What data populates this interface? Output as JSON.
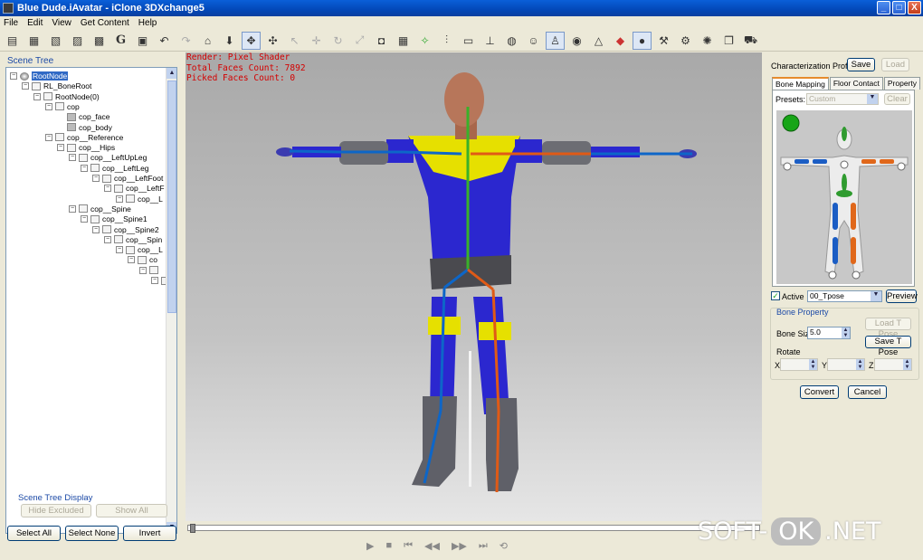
{
  "window": {
    "title": "Blue Dude.iAvatar - iClone 3DXchange5",
    "controls": [
      "_",
      "□",
      "X"
    ]
  },
  "menu": [
    "File",
    "Edit",
    "View",
    "Get Content",
    "Help"
  ],
  "toolbar": {
    "icons": [
      "open-icon",
      "import-icon",
      "export-icon",
      "export-icon",
      "save-icon",
      "g-icon",
      "grid-icon",
      "undo-icon",
      "redo-icon",
      "home-icon",
      "down-arrow-icon",
      "move-icon",
      "rotate-icon",
      "pan-icon",
      "move-icon",
      "rotate-icon",
      "scale-icon",
      "frame-icon",
      "grid-icon",
      "pose-icon",
      "bone-icon",
      "plane-icon",
      "pivot-icon",
      "sphere-icon",
      "human-icon",
      "camera-icon",
      "triangle-icon",
      "flag-icon",
      "sphere-icon",
      "wrench-icon",
      "gear-icon",
      "gear-icon",
      "copy-icon",
      "cart-icon"
    ],
    "g_label": "G"
  },
  "scene_tree": {
    "caption": "Scene Tree",
    "nodes": [
      {
        "label": "RootNode",
        "depth": 0,
        "icon": "root",
        "selected": true
      },
      {
        "label": "RL_BoneRoot",
        "depth": 1
      },
      {
        "label": "RootNode(0)",
        "depth": 2
      },
      {
        "label": "cop",
        "depth": 3
      },
      {
        "label": "cop_face",
        "depth": 4,
        "icon": "mesh"
      },
      {
        "label": "cop_body",
        "depth": 4,
        "icon": "mesh"
      },
      {
        "label": "cop__Reference",
        "depth": 3
      },
      {
        "label": "cop__Hips",
        "depth": 4
      },
      {
        "label": "cop__LeftUpLeg",
        "depth": 5
      },
      {
        "label": "cop__LeftLeg",
        "depth": 6
      },
      {
        "label": "cop__LeftFoot",
        "depth": 7
      },
      {
        "label": "cop__LeftF",
        "depth": 8
      },
      {
        "label": "cop__L",
        "depth": 9
      },
      {
        "label": "cop__Spine",
        "depth": 5
      },
      {
        "label": "cop__Spine1",
        "depth": 6
      },
      {
        "label": "cop__Spine2",
        "depth": 7
      },
      {
        "label": "cop__Spin",
        "depth": 8
      },
      {
        "label": "cop__L",
        "depth": 9
      },
      {
        "label": "co",
        "depth": 10
      },
      {
        "label": "",
        "depth": 11
      },
      {
        "label": "",
        "depth": 12
      }
    ],
    "display_caption": "Scene Tree Display",
    "hide_excluded": "Hide Excluded",
    "show_all": "Show All",
    "select_all": "Select All",
    "select_none": "Select None",
    "invert": "Invert"
  },
  "viewport": {
    "render_line": "Render: Pixel Shader",
    "total_faces_line": "Total Faces Count: 7892",
    "picked_faces_line": "Picked Faces Count: 0"
  },
  "playback": {
    "controls": [
      "play-icon",
      "stop-icon",
      "first-frame-icon",
      "rewind-icon",
      "forward-icon",
      "last-frame-icon",
      "loop-icon"
    ],
    "glyphs": [
      "▶",
      "■",
      "⏮",
      "◀◀",
      "▶▶",
      "⏭",
      "⟲"
    ]
  },
  "characterization": {
    "profile_label": "Characterization Profile",
    "save": "Save",
    "load": "Load",
    "tabs": [
      "Bone Mapping",
      "Floor Contact",
      "Property"
    ],
    "presets_label": "Presets:",
    "presets_value": "Custom",
    "clear": "Clear",
    "active_label": "Active",
    "active_checked": true,
    "tpose_value": "00_Tpose",
    "preview": "Preview",
    "bone_property": "Bone Property",
    "bone_size_label": "Bone Size",
    "bone_size_value": "5.0",
    "load_tpose": "Load T Pose",
    "save_tpose": "Save T Pose",
    "rotate_label": "Rotate",
    "x_label": "X",
    "y_label": "Y",
    "z_label": "Z",
    "convert": "Convert",
    "cancel": "Cancel"
  },
  "watermark": {
    "left": "SOFT-",
    "ok": "OK",
    "right": ".NET"
  }
}
